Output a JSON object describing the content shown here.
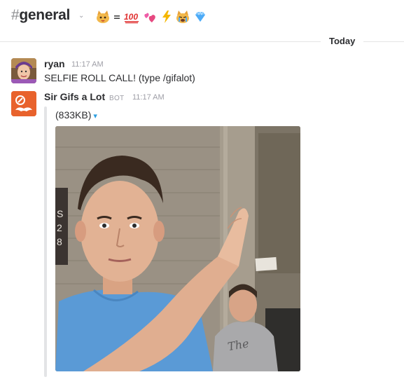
{
  "channel": {
    "hash": "#",
    "name": "general",
    "emoji_status": [
      "cat-face",
      "equals",
      "hundred-points",
      "two-hearts",
      "lightning",
      "crying-cat",
      "gem"
    ]
  },
  "divider": {
    "label": "Today"
  },
  "messages": [
    {
      "author": "ryan",
      "time": "11:17 AM",
      "text": "SELFIE ROLL CALL! (type /gifalot)"
    },
    {
      "author": "Sir Gifs a Lot",
      "badge": "BOT",
      "time": "11:17 AM",
      "attachment": {
        "size": "(833KB)",
        "caret": "▾"
      }
    }
  ],
  "colors": {
    "accent": "#2d9ee0",
    "bot_avatar": "#e8622c"
  }
}
